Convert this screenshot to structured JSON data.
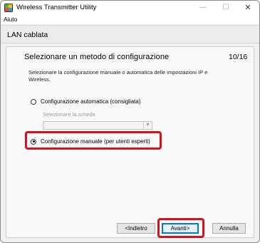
{
  "window": {
    "title": "Wireless Transmitter Utility",
    "controls": {
      "minimize": "—",
      "maximize": "☐",
      "close": "✕"
    }
  },
  "menu": {
    "items": [
      "Aiuto"
    ]
  },
  "header": {
    "section": "LAN cablata"
  },
  "step": {
    "title": "Selezionare un metodo di configurazione",
    "counter": "10/16",
    "description": "Selezionare la configurazione manuale o automatica delle impostazioni IP e Wireless."
  },
  "options": {
    "auto": {
      "label": "Configurazione automatica (consigliata)",
      "checked": false
    },
    "card_label": "Selezionare la scheda",
    "card_select_value": "",
    "manual": {
      "label": "Configurazione manuale (per utenti esperti)",
      "checked": true
    }
  },
  "buttons": {
    "back": "<Indietro",
    "next": "Avanti>",
    "cancel": "Annulla"
  },
  "colors": {
    "highlight": "#d3121c",
    "focus": "#0078d7"
  }
}
